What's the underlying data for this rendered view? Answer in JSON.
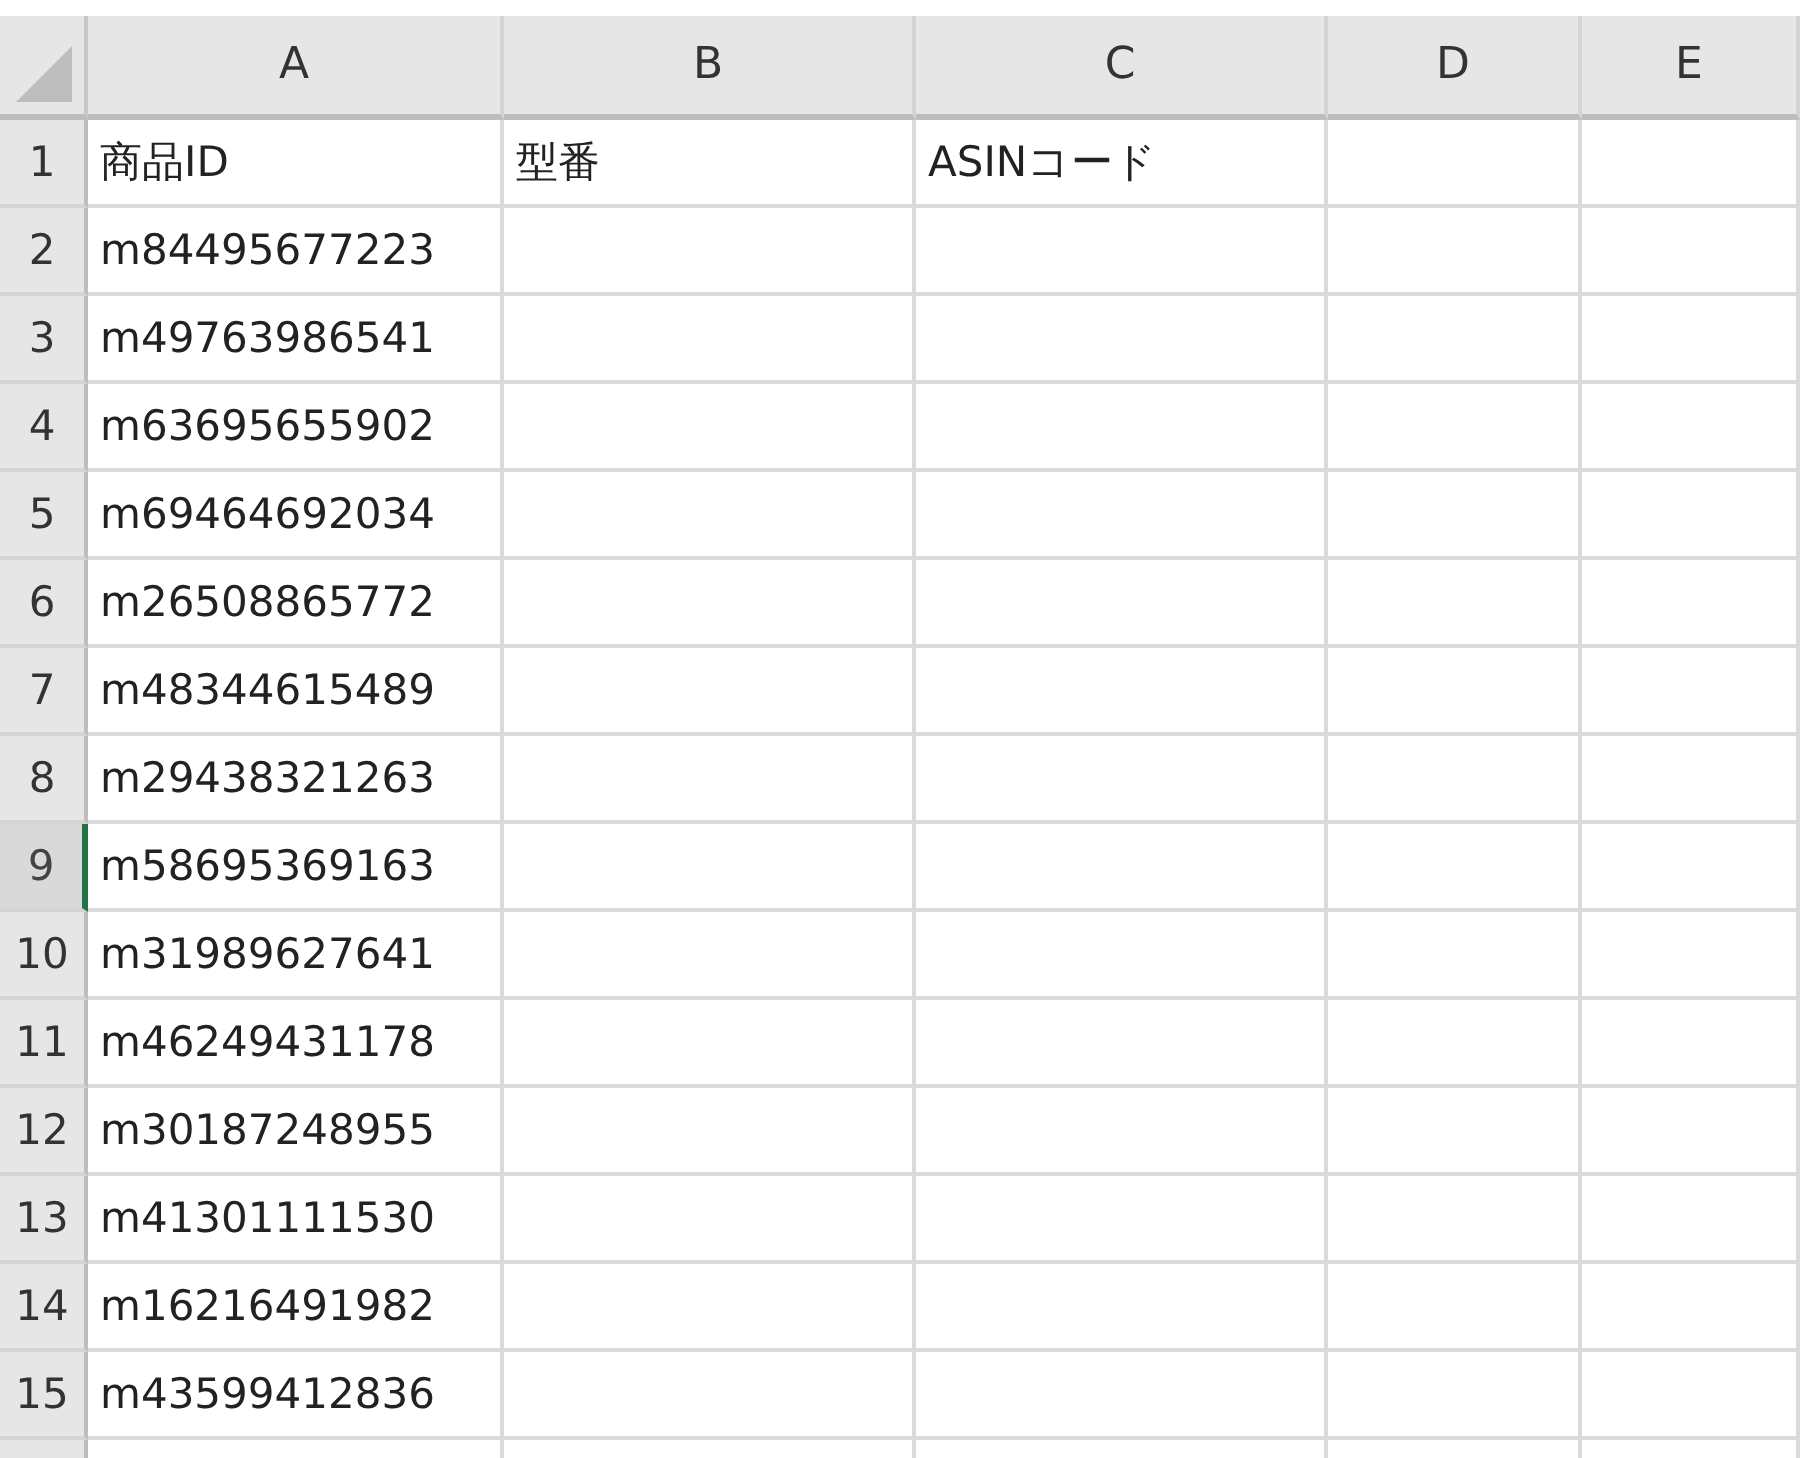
{
  "spreadsheet": {
    "columns": [
      "A",
      "B",
      "C",
      "D",
      "E"
    ],
    "rows": [
      {
        "number": "1",
        "selected": false,
        "cells": [
          "商品ID",
          "型番",
          "ASINコード"
        ]
      },
      {
        "number": "2",
        "selected": false,
        "cells": [
          "m84495677223"
        ]
      },
      {
        "number": "3",
        "selected": false,
        "cells": [
          "m49763986541"
        ]
      },
      {
        "number": "4",
        "selected": false,
        "cells": [
          "m63695655902"
        ]
      },
      {
        "number": "5",
        "selected": false,
        "cells": [
          "m69464692034"
        ]
      },
      {
        "number": "6",
        "selected": false,
        "cells": [
          "m26508865772"
        ]
      },
      {
        "number": "7",
        "selected": false,
        "cells": [
          "m48344615489"
        ]
      },
      {
        "number": "8",
        "selected": false,
        "cells": [
          "m29438321263"
        ]
      },
      {
        "number": "9",
        "selected": true,
        "cells": [
          "m58695369163"
        ]
      },
      {
        "number": "10",
        "selected": false,
        "cells": [
          "m31989627641"
        ]
      },
      {
        "number": "11",
        "selected": false,
        "cells": [
          "m46249431178"
        ]
      },
      {
        "number": "12",
        "selected": false,
        "cells": [
          "m30187248955"
        ]
      },
      {
        "number": "13",
        "selected": false,
        "cells": [
          "m41301111530"
        ]
      },
      {
        "number": "14",
        "selected": false,
        "cells": [
          "m16216491982"
        ]
      },
      {
        "number": "15",
        "selected": false,
        "cells": [
          "m43599412836"
        ]
      }
    ]
  }
}
